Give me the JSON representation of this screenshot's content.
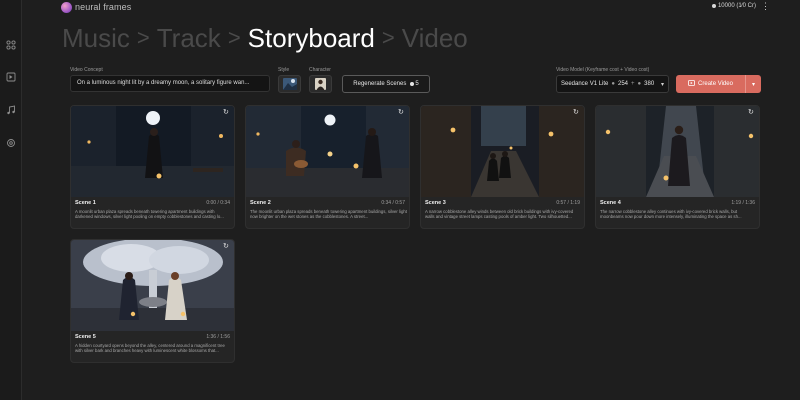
{
  "brand": {
    "name": "neural frames"
  },
  "credits": {
    "text": "10000 (1⁄0 Cr)"
  },
  "header": {
    "more": "⋮"
  },
  "steps": [
    {
      "label": "Music"
    },
    {
      "label": "Track"
    },
    {
      "label": "Storyboard"
    },
    {
      "label": "Video"
    }
  ],
  "step_separator": ">",
  "controls": {
    "video_concept_label": "Video Concept",
    "video_concept_value": "On a luminous night lit by a dreamy moon, a solitary figure wan...",
    "style_label": "Style",
    "character_label": "Character",
    "regenerate_label": "Regenerate Scenes",
    "regenerate_cost": "5",
    "video_model_label": "Video Model (Keyframe cost + Video cost)",
    "video_model_name": "Seedance V1 Lite",
    "video_model_cost_a": "254",
    "video_model_cost_b": "380",
    "create_label": "Create Video"
  },
  "scenes": [
    {
      "title": "Scene 1",
      "time": "0:00 / 0:34",
      "desc": "A moonlit urban plaza spreads beneath towering apartment buildings with darkened windows, silver light pooling on empty cobblestones and casting lo..."
    },
    {
      "title": "Scene 2",
      "time": "0:34 / 0:57",
      "desc": "The moonlit urban plaza spreads beneath towering apartment buildings, silver light now brighter on the wet stones as the cobblestones. A street..."
    },
    {
      "title": "Scene 3",
      "time": "0:57 / 1:19",
      "desc": "A narrow cobblestone alley winds between old brick buildings with ivy-covered walls and vintage street lamps casting pools of amber light. Two silhouetted..."
    },
    {
      "title": "Scene 4",
      "time": "1:19 / 1:36",
      "desc": "The narrow cobblestone alley continues with ivy-covered brick walls, but moonbeams now pour down more intensely, illuminating the space as sh..."
    },
    {
      "title": "Scene 5",
      "time": "1:36 / 1:56",
      "desc": "A hidden courtyard opens beyond the alley, centered around a magnificent tree with silver bark and branches heavy with luminescent white blossoms that..."
    }
  ],
  "colors": {
    "accent": "#d96b5f",
    "background": "#1e1e1e",
    "card": "#252525"
  },
  "icons": {
    "sidebar": [
      "grid-icon",
      "frame-icon",
      "music-icon",
      "settings-icon"
    ]
  }
}
